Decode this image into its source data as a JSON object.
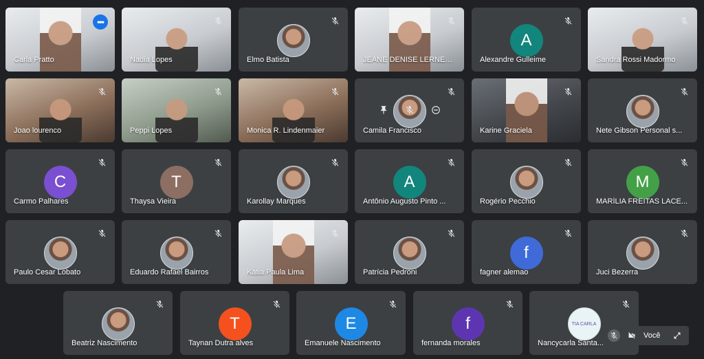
{
  "participants": [
    {
      "name": "Carla Pratto",
      "kind": "video",
      "tone": "light",
      "portrait": true,
      "speaking": true,
      "badge": "more"
    },
    {
      "name": "Nadia Lopes",
      "kind": "video",
      "tone": "light"
    },
    {
      "name": "Elmo Batista",
      "kind": "photo"
    },
    {
      "name": "JEANE DENISE LERNER...",
      "kind": "video",
      "tone": "light",
      "portrait": true
    },
    {
      "name": "Alexandre Gulleime",
      "kind": "letter",
      "letter": "A",
      "color": "#12857c"
    },
    {
      "name": "Sandra Rossi Madormo",
      "kind": "video",
      "tone": "light"
    },
    {
      "name": "Joao lourenco",
      "kind": "video",
      "tone": "warm"
    },
    {
      "name": "Peppi Lopes",
      "kind": "video",
      "tone": "green"
    },
    {
      "name": "Monica R. Lindenmaier",
      "kind": "video",
      "tone": "warm"
    },
    {
      "name": "Camila Francisco",
      "kind": "photo",
      "hover": true
    },
    {
      "name": "Karine Graciela",
      "kind": "video",
      "tone": "dark",
      "portrait": true
    },
    {
      "name": "Nete Gibson Personal s...",
      "kind": "photo"
    },
    {
      "name": "Carmo Palhares",
      "kind": "letter",
      "letter": "C",
      "color": "#7b4fd1"
    },
    {
      "name": "Thaysa Vieira",
      "kind": "letter",
      "letter": "T",
      "color": "#8d6e63"
    },
    {
      "name": "Karollay Marques",
      "kind": "photo"
    },
    {
      "name": "Antônio Augusto Pinto ...",
      "kind": "letter",
      "letter": "A",
      "color": "#12857c"
    },
    {
      "name": "Rogério Pecchio",
      "kind": "photo"
    },
    {
      "name": "MARÍLIA FREITAS LACE...",
      "kind": "letter",
      "letter": "M",
      "color": "#43a047"
    },
    {
      "name": "Paulo Cesar Lobato",
      "kind": "photo"
    },
    {
      "name": "Eduardo Rafael Bairros",
      "kind": "photo"
    },
    {
      "name": "Katia Paula Lima",
      "kind": "video",
      "tone": "light",
      "portrait": true
    },
    {
      "name": "Patrícia Pedroni",
      "kind": "photo"
    },
    {
      "name": "fagner alemao",
      "kind": "letter",
      "letter": "f",
      "color": "#3f6ad8"
    },
    {
      "name": "Juci Bezerra",
      "kind": "photo"
    },
    {
      "name": "Beatriz Nascimento",
      "kind": "photo"
    },
    {
      "name": "Taynan Dutra alves",
      "kind": "letter",
      "letter": "T",
      "color": "#f4511e"
    },
    {
      "name": "Emanuele Nascimento",
      "kind": "letter",
      "letter": "E",
      "color": "#1e88e5"
    },
    {
      "name": "fernanda morales",
      "kind": "letter",
      "letter": "f",
      "color": "#5e35b1"
    },
    {
      "name": "Nancycarla Santa...",
      "kind": "photo",
      "logo_text": "TIA CARLA"
    }
  ],
  "self_view": {
    "label": "Você"
  },
  "icons": {
    "muted_mic": "mic-off-icon",
    "more": "more-options-icon",
    "pin": "pin-icon",
    "remove": "remove-icon",
    "camera_off": "camera-off-icon",
    "expand": "expand-icon"
  },
  "colors": {
    "background": "#202124",
    "tile": "#3c4043",
    "accent": "#8ab4f8",
    "more_button": "#1a73e8"
  }
}
